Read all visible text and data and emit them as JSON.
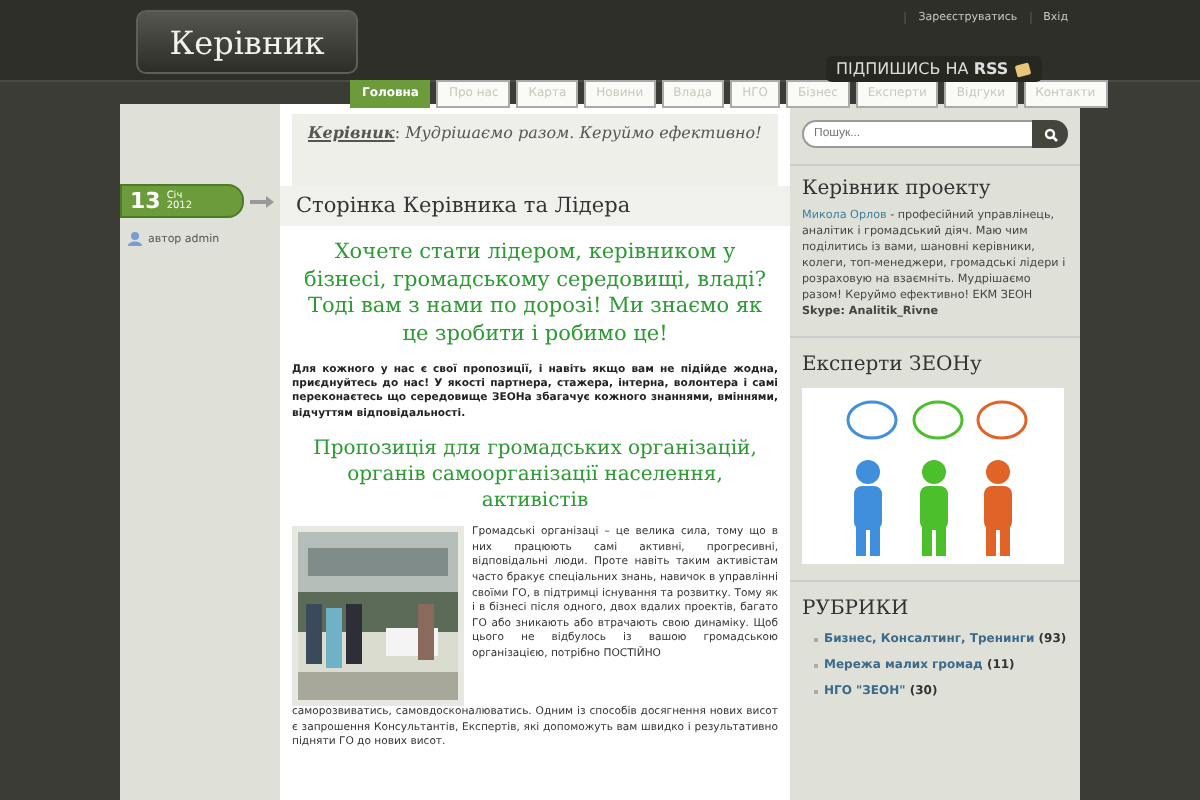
{
  "header": {
    "logo": "Керівник",
    "top_links": [
      "Зареєструватись",
      "Вхід"
    ],
    "rss": {
      "label": "ПІДПИШИСЬ НА",
      "strong": "RSS"
    }
  },
  "nav": [
    {
      "label": "Головна",
      "selected": true
    },
    {
      "label": "Про нас",
      "selected": false
    },
    {
      "label": "Карта",
      "selected": false
    },
    {
      "label": "Новини",
      "selected": false
    },
    {
      "label": "Влада",
      "selected": false
    },
    {
      "label": "НГО",
      "selected": false
    },
    {
      "label": "Бізнес",
      "selected": false
    },
    {
      "label": "Експерти",
      "selected": false
    },
    {
      "label": "Відгуки",
      "selected": false
    },
    {
      "label": "Контакти",
      "selected": false
    }
  ],
  "post": {
    "day": "13",
    "month": "Січ",
    "year": "2012",
    "author": "автор admin"
  },
  "tagline": "**Керівник**: *Мудрішаємо разом. Керуймо ефективно!*",
  "title": "Сторінка Керівника та Лідера",
  "heading_1": "Хочете стати лідером, керівником у бізнесі, громадському середовищі, владі? Тоді вам з нами по дорозі! Ми знаємо як це зробити і робимо це!",
  "intro": "Для кожного у нас є свої пропозиції, і навіть якщо вам не підійде жодна, приєднуйтесь до нас! У якості партнера, стажера, інтерна, волонтера і самі переконаєтесь що середовище ЗЕОНа збагачує кожного знаннями, вміннями, відчуттям відповідальності.",
  "heading_2": "Пропозиція для громадських організацій, органів самоорганізації населення, активістів",
  "body": "Громадські організаці – це велика сила, тому що в них працюють самі активні, прогресивні, відповідальні люди. Проте навіть таким активістам часто бракує спеціальних знань, навичок в управлінні своїми ГО, в підтримці існування та розвитку. Тому як і в бізнесі після одного, двох вдалих проектів, багато ГО або зникають або втрачають свою динаміку. Щоб цього не відбулось із вашою громадською організацією, потрібно ПОСТІЙНО",
  "body_continued": "саморозвиватись, самовдосконалюватись. Одним із способів досягнення нових висот є запрошення Консультантів, Експертів, які допоможуть вам швидко і результативно підняти ГО до нових висот.",
  "sidebar": {
    "search": {
      "placeholder": "Пошук..."
    },
    "about": {
      "title": "Керівник проекту",
      "link": "Микола Орлов",
      "text": " - професійний управлінець, аналітик і громадський діяч. Маю чим поділитись із вами, шановні керівники, колеги, топ-менеджери, громадські лідери і розраховую на взаємніть. Мудрішаємо разом! Керуймо ефективно! ЕКМ ЗЕОН **Skype: Analitik_Rivne**"
    },
    "experts_title": "Експерти ЗЕОНу",
    "rubrics_title": "РУБРИКИ",
    "rubrics": [
      {
        "name": "Бизнес, Консалтинг, Тренинги",
        "count": "(93)"
      },
      {
        "name": "Мережа малих громад",
        "count": "(11)"
      },
      {
        "name": "НГО \"ЗЕОН\"",
        "count": "(30)"
      }
    ]
  }
}
